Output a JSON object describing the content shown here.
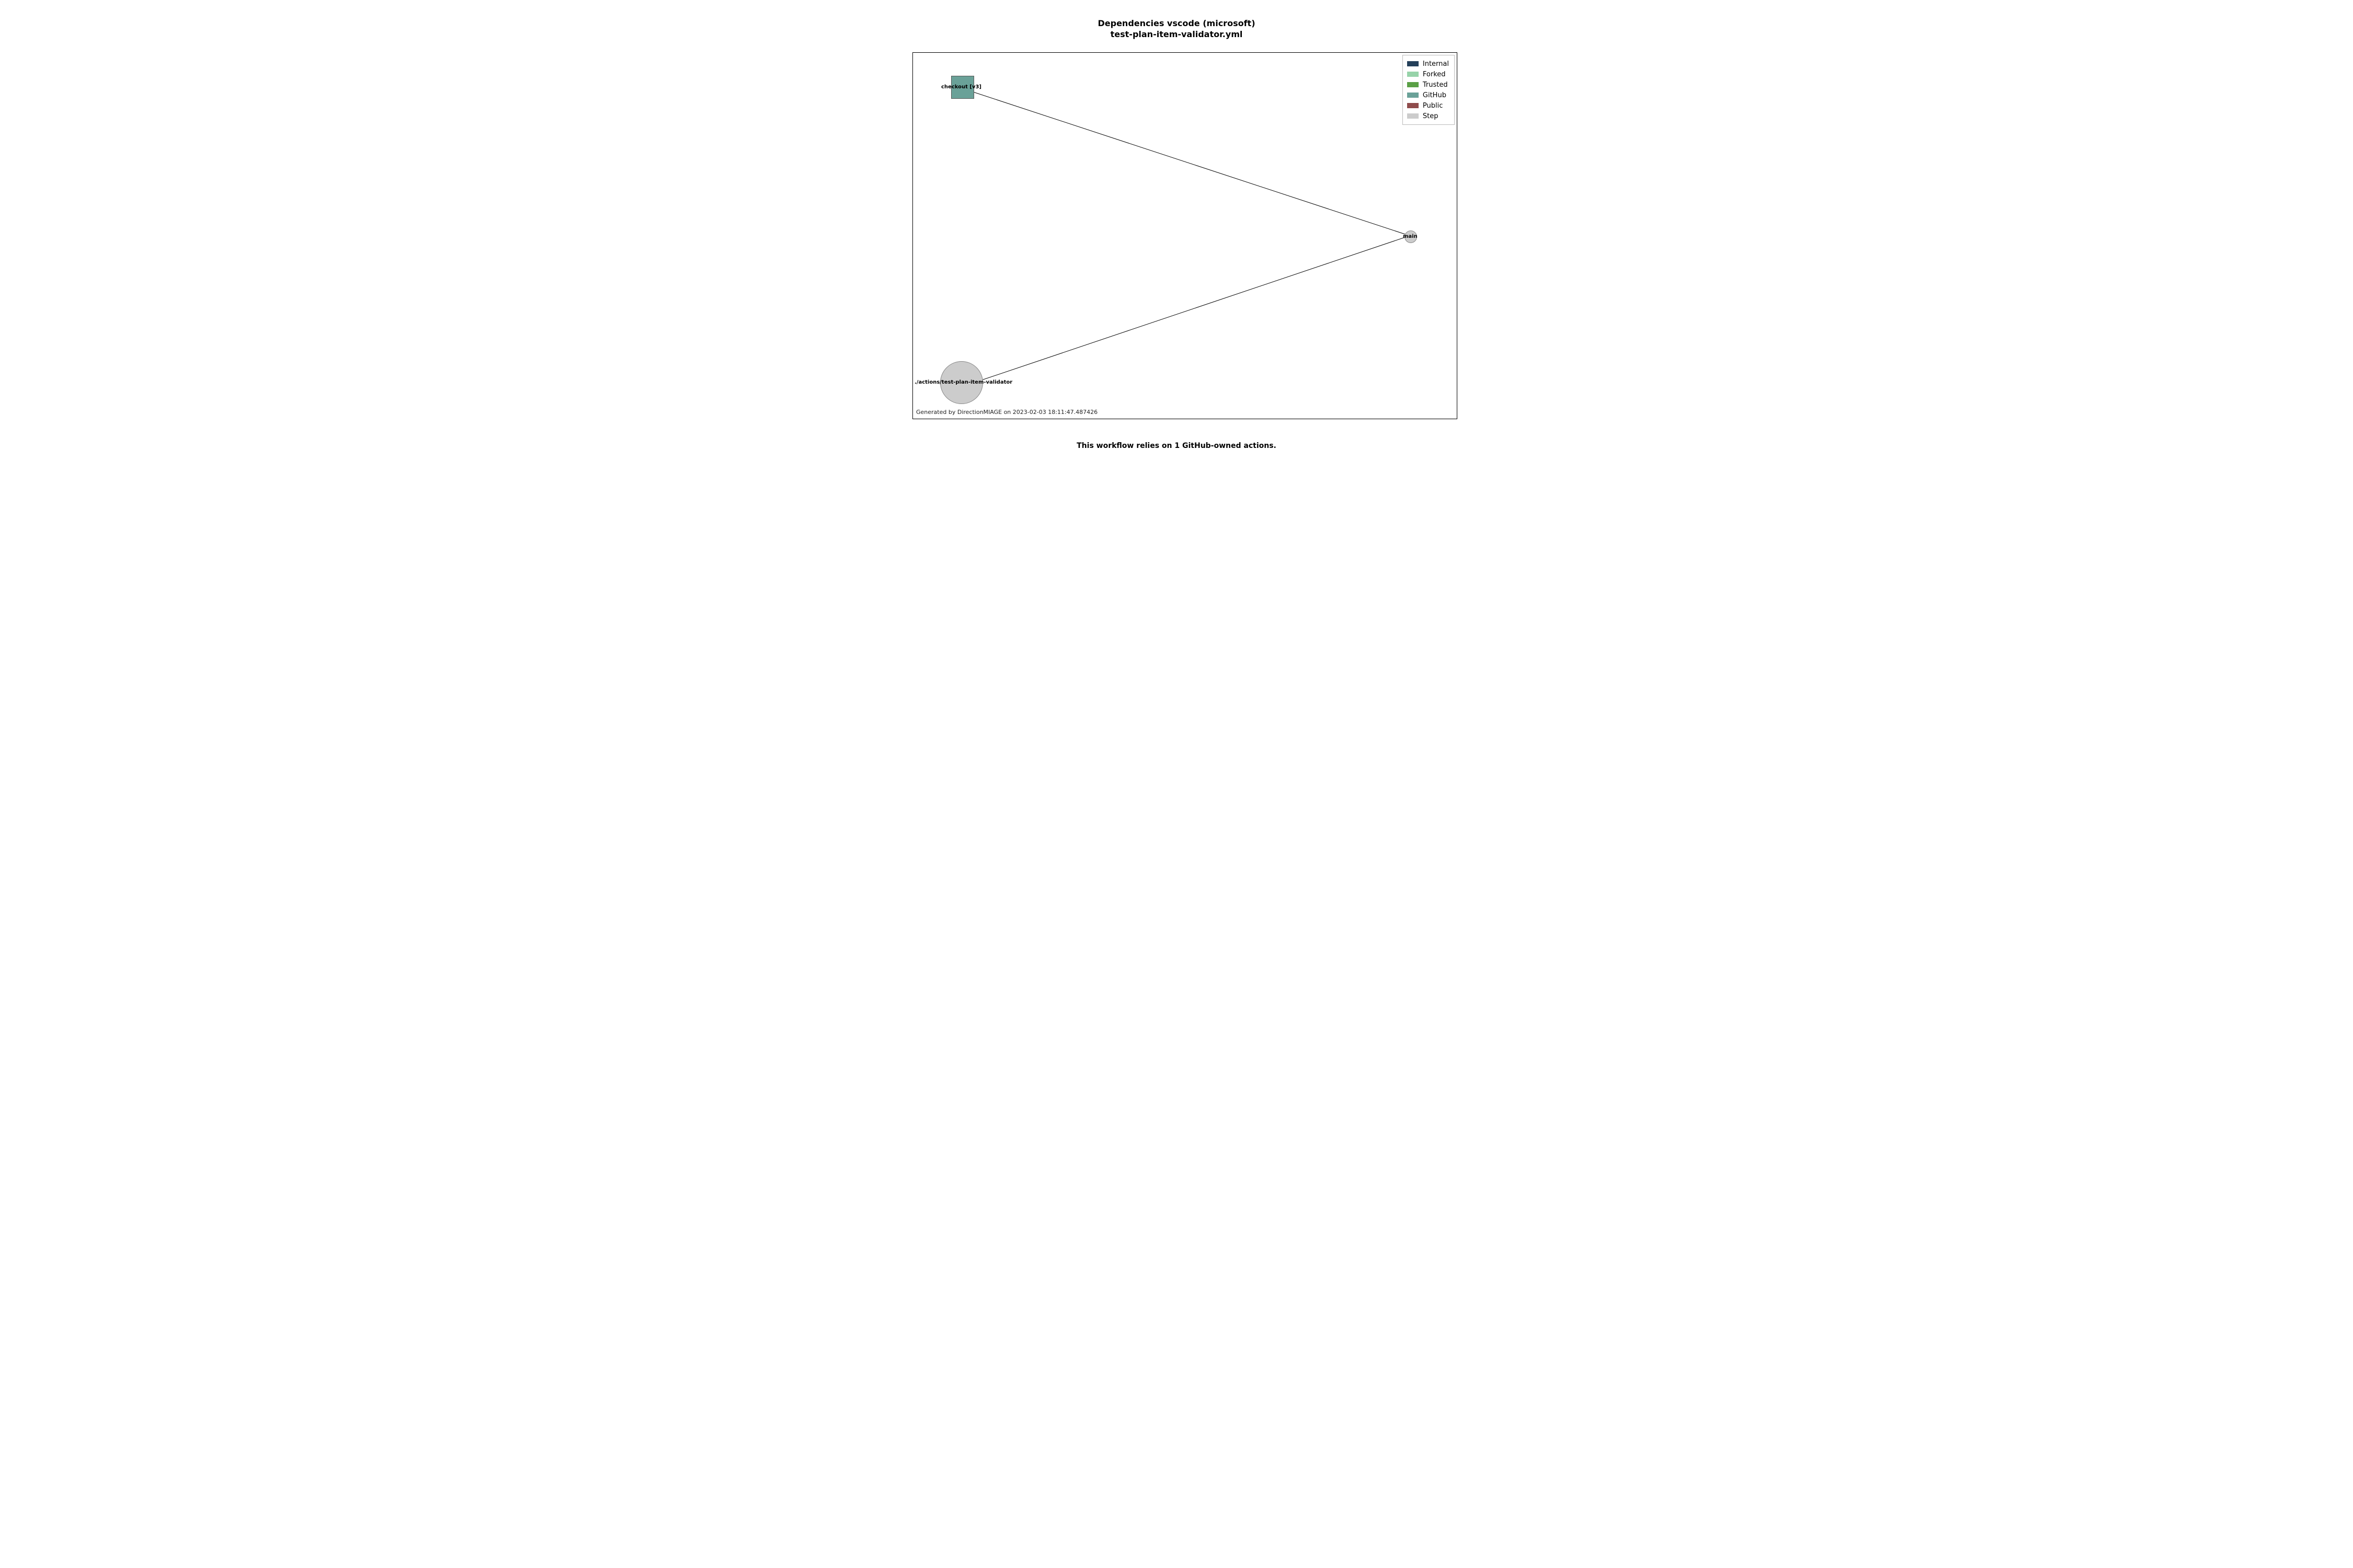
{
  "title_line1": "Dependencies vscode (microsoft)",
  "title_line2": "test-plan-item-validator.yml",
  "nodes": {
    "checkout": {
      "label": "checkout [v3]"
    },
    "main": {
      "label": "main"
    },
    "validator": {
      "label": "./actions/test-plan-item-validator"
    }
  },
  "legend": {
    "internal": {
      "label": "Internal",
      "color": "#24405a"
    },
    "forked": {
      "label": "Forked",
      "color": "#97d3a9"
    },
    "trusted": {
      "label": "Trusted",
      "color": "#5aa046"
    },
    "github": {
      "label": "GitHub",
      "color": "#6aa198"
    },
    "public": {
      "label": "Public",
      "color": "#8f4c4c"
    },
    "step": {
      "label": "Step",
      "color": "#cccccc"
    }
  },
  "generated_by": "Generated by DirectionMIAGE on 2023-02-03 18:11:47.487426",
  "caption": "This workflow relies on 1 GitHub-owned actions.",
  "chart_data": {
    "type": "graph",
    "title": "Dependencies vscode (microsoft) test-plan-item-validator.yml",
    "nodes": [
      {
        "id": "main",
        "label": "main",
        "category": "Step",
        "shape": "circle"
      },
      {
        "id": "checkout",
        "label": "checkout [v3]",
        "category": "GitHub",
        "shape": "square"
      },
      {
        "id": "validator",
        "label": "./actions/test-plan-item-validator",
        "category": "Step",
        "shape": "circle"
      }
    ],
    "edges": [
      {
        "from": "main",
        "to": "checkout"
      },
      {
        "from": "main",
        "to": "validator"
      }
    ],
    "legend_categories": [
      "Internal",
      "Forked",
      "Trusted",
      "GitHub",
      "Public",
      "Step"
    ]
  }
}
